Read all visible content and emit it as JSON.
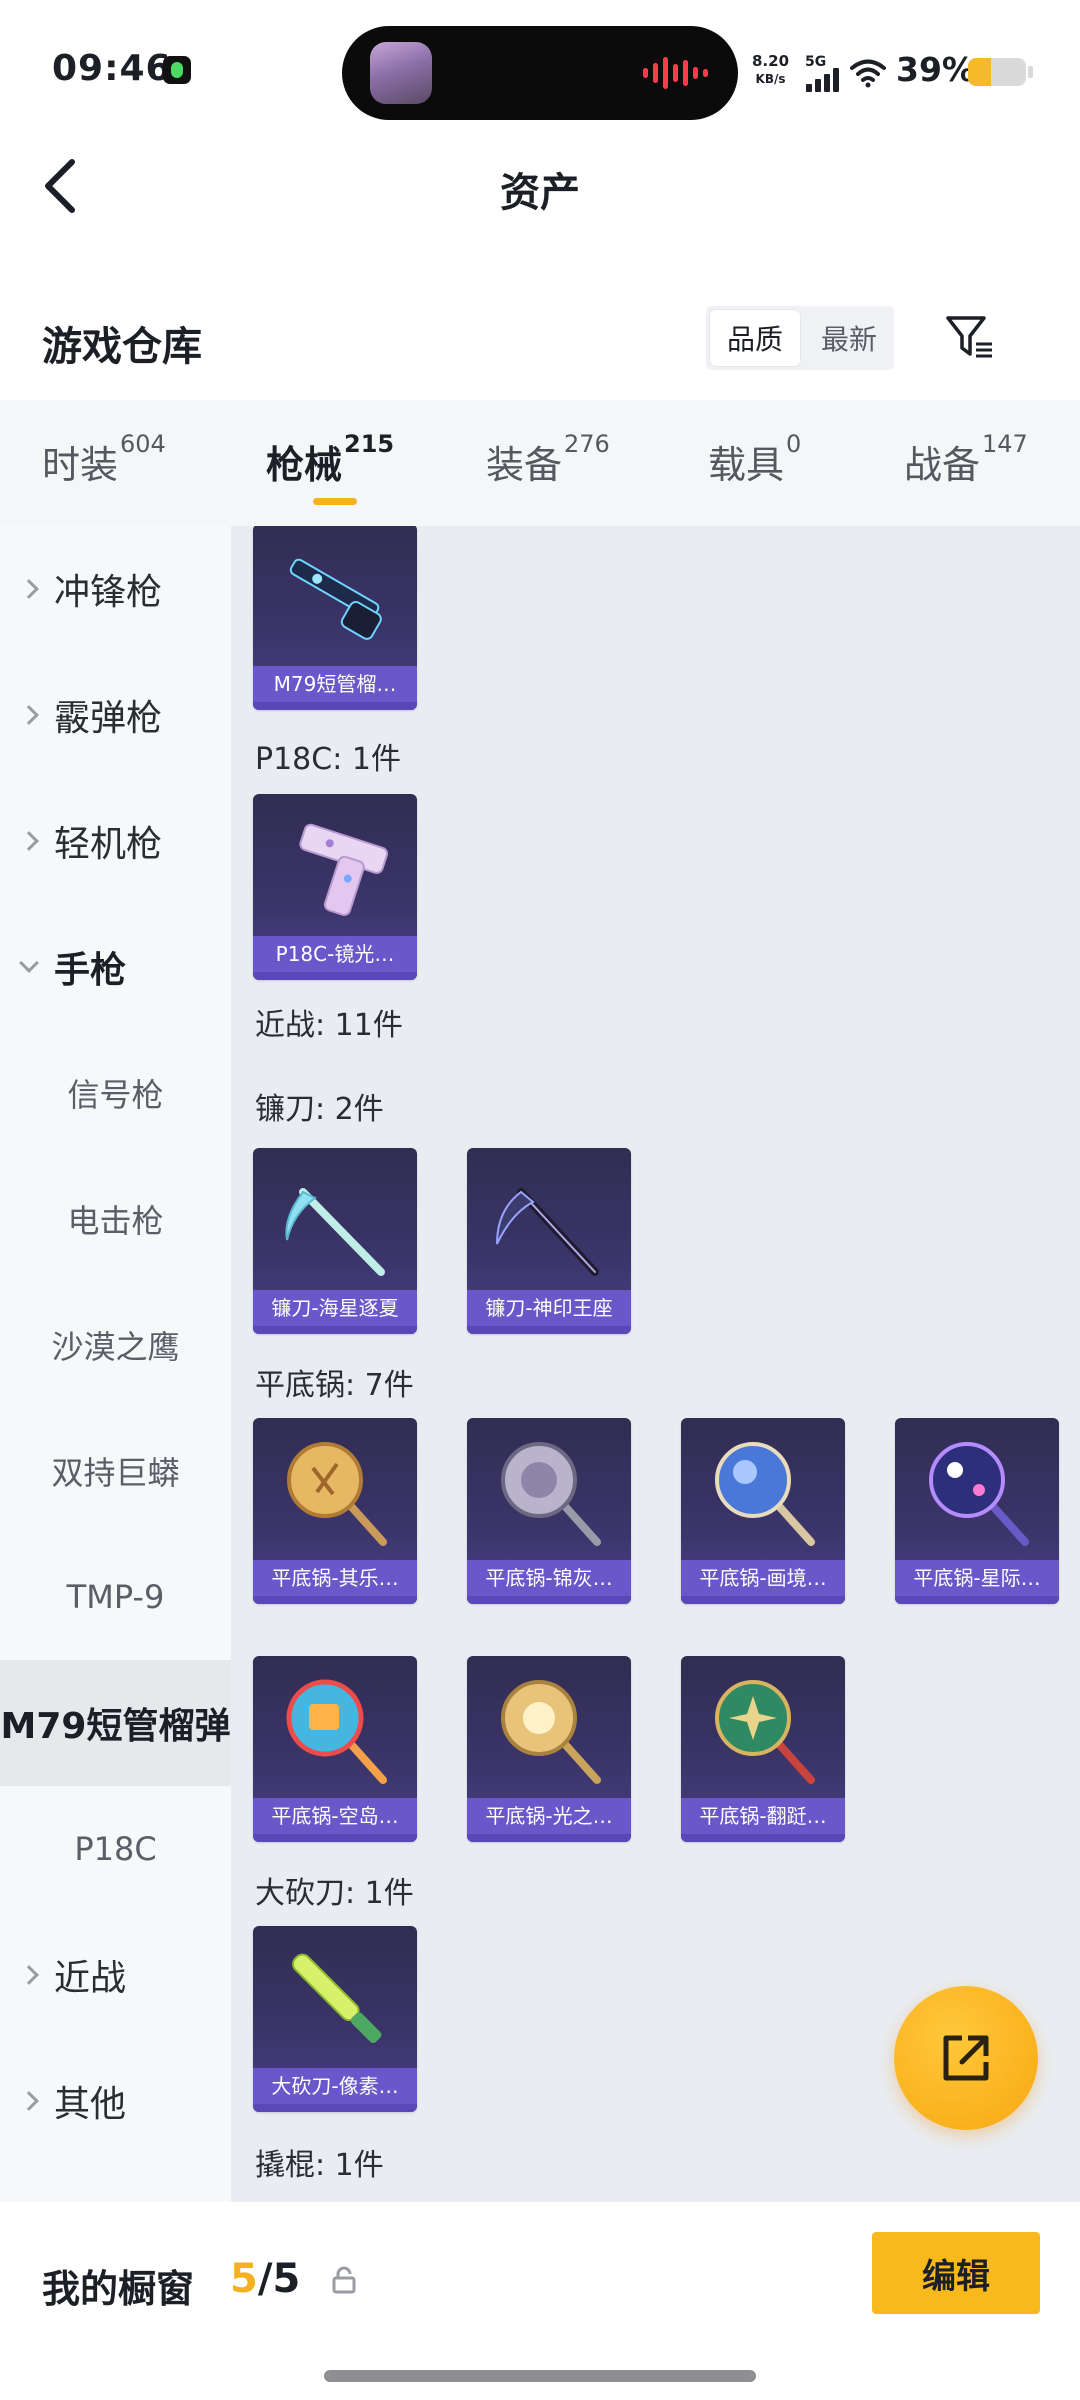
{
  "status_bar": {
    "time": "09:46",
    "net_speed_value": "8.20",
    "net_speed_unit": "KB/s",
    "network_type": "5G",
    "battery_percent": "39%",
    "battery_level": 0.39,
    "wave_color": "#ff3b4a"
  },
  "header": {
    "title": "资产",
    "back_icon": "chevron-left-icon"
  },
  "section": {
    "title": "游戏仓库",
    "sort_options": [
      "品质",
      "最新"
    ],
    "sort_selected": "品质",
    "filter_icon": "filter-icon"
  },
  "tabs": [
    {
      "label": "时装",
      "count": "604"
    },
    {
      "label": "枪械",
      "count": "215",
      "active": true
    },
    {
      "label": "装备",
      "count": "276"
    },
    {
      "label": "载具",
      "count": "0"
    },
    {
      "label": "战备",
      "count": "147"
    }
  ],
  "sidebar": {
    "items": [
      {
        "label": "冲锋枪",
        "type": "parent"
      },
      {
        "label": "霰弹枪",
        "type": "parent"
      },
      {
        "label": "轻机枪",
        "type": "parent"
      },
      {
        "label": "手枪",
        "type": "parent-open"
      },
      {
        "label": "信号枪",
        "type": "child"
      },
      {
        "label": "电击枪",
        "type": "child"
      },
      {
        "label": "沙漠之鹰",
        "type": "child"
      },
      {
        "label": "双持巨蟒",
        "type": "child"
      },
      {
        "label": "TMP-9",
        "type": "child"
      },
      {
        "label": "M79短管榴弹",
        "type": "child",
        "selected": true
      },
      {
        "label": "P18C",
        "type": "child"
      },
      {
        "label": "近战",
        "type": "parent"
      },
      {
        "label": "其他",
        "type": "parent"
      }
    ]
  },
  "content": {
    "groups": {
      "p18c": "P18C: 1件",
      "melee": "近战: 11件",
      "sickle": "镰刀: 2件",
      "pan": "平底锅: 7件",
      "machete": "大砍刀: 1件",
      "crowbar": "撬棍: 1件"
    },
    "cards": {
      "m79": "M79短管榴…",
      "p18c": "P18C-镜光…",
      "sickle1": "镰刀-海星逐夏",
      "sickle2": "镰刀-神印王座",
      "pan1": "平底锅-其乐…",
      "pan2": "平底锅-锦灰…",
      "pan3": "平底锅-画境…",
      "pan4": "平底锅-星际…",
      "pan5": "平底锅-空岛…",
      "pan6": "平底锅-光之…",
      "pan7": "平底锅-翻跹…",
      "machete1": "大砍刀-像素…"
    }
  },
  "fab": {
    "icon": "share-external-icon"
  },
  "bottom_bar": {
    "label": "我的橱窗",
    "count_current": "5",
    "count_sep": "/",
    "count_total": "5",
    "lock_icon": "lock-icon",
    "edit_label": "编辑"
  },
  "colors": {
    "accent": "#f5b11f",
    "card_label_bg": "#6a57c9",
    "card_bg": "#3a3468"
  }
}
